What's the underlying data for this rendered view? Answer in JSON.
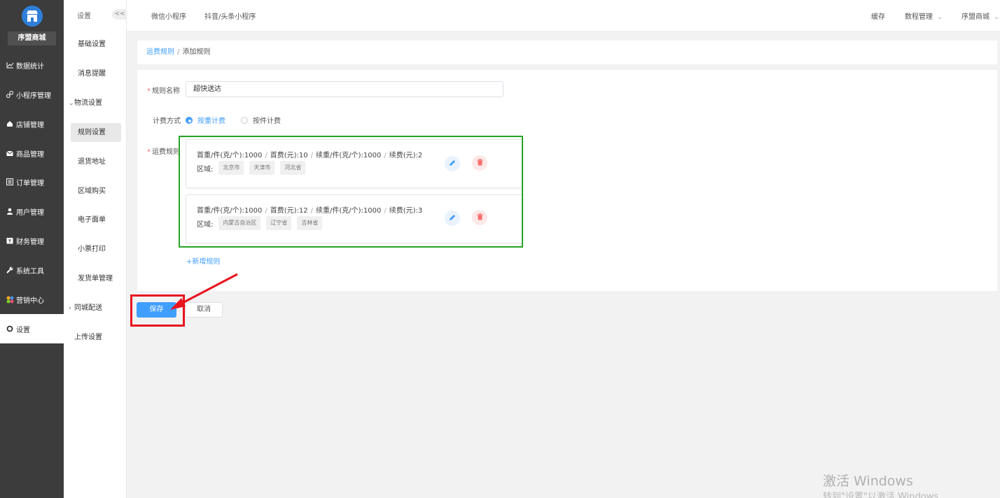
{
  "sidebar": {
    "shop_name": "序盟商城",
    "items": [
      {
        "label": "数据统计",
        "icon": "chart-icon"
      },
      {
        "label": "小程序管理",
        "icon": "link-icon"
      },
      {
        "label": "店铺管理",
        "icon": "home-icon"
      },
      {
        "label": "商品管理",
        "icon": "mail-icon"
      },
      {
        "label": "订单管理",
        "icon": "list-icon"
      },
      {
        "label": "用户管理",
        "icon": "user-icon"
      },
      {
        "label": "财务管理",
        "icon": "finance-icon"
      },
      {
        "label": "系统工具",
        "icon": "wrench-icon"
      },
      {
        "label": "营销中心",
        "icon": "marketing-icon"
      },
      {
        "label": "设置",
        "icon": "gear-icon",
        "active": true
      }
    ]
  },
  "submenu": {
    "title": "设置",
    "collapse": "<<",
    "items": [
      {
        "label": "基础设置"
      },
      {
        "label": "消息提醒"
      },
      {
        "label": "物流设置",
        "expanded": true
      },
      {
        "label": "规则设置",
        "active": true
      },
      {
        "label": "退货地址"
      },
      {
        "label": "区域购买"
      },
      {
        "label": "电子面单"
      },
      {
        "label": "小票打印"
      },
      {
        "label": "发货单管理"
      },
      {
        "label": "同城配送",
        "collapsed": true
      },
      {
        "label": "上传设置"
      }
    ]
  },
  "topbar": {
    "tabs": [
      "微信小程序",
      "抖音/头条小程序"
    ],
    "cache": "缓存",
    "account": "数程管理",
    "store": "序盟商城"
  },
  "breadcrumb": {
    "parent": "运费规则",
    "separator": "/",
    "current": "添加规则"
  },
  "form": {
    "name_label": "规则名称",
    "name_value": "超快送达",
    "billing_label": "计费方式",
    "billing_options": [
      "按重计费",
      "按件计费"
    ],
    "billing_selected": "按重计费",
    "rules_label": "运费规则",
    "rules": [
      {
        "parts": [
          "首重/件(克/个):1000",
          "首费(元):10",
          "续重/件(克/个):1000",
          "续费(元):2"
        ],
        "region_label": "区域:",
        "regions": [
          "北京市",
          "天津市",
          "河北省"
        ]
      },
      {
        "parts": [
          "首重/件(克/个):1000",
          "首费(元):12",
          "续重/件(克/个):1000",
          "续费(元):3"
        ],
        "region_label": "区域:",
        "regions": [
          "内蒙古自治区",
          "辽宁省",
          "吉林省"
        ]
      }
    ],
    "add_rule": "+新增规则"
  },
  "actions": {
    "save": "保存",
    "cancel": "取消"
  },
  "watermark": {
    "line1": "激活 Windows",
    "line2": "转到\"设置\"以激活 Windows"
  },
  "colors": {
    "primary": "#409eff",
    "sidebar_bg": "#3c3c3c",
    "highlight_green": "#27a327",
    "highlight_red": "#e8141e"
  }
}
